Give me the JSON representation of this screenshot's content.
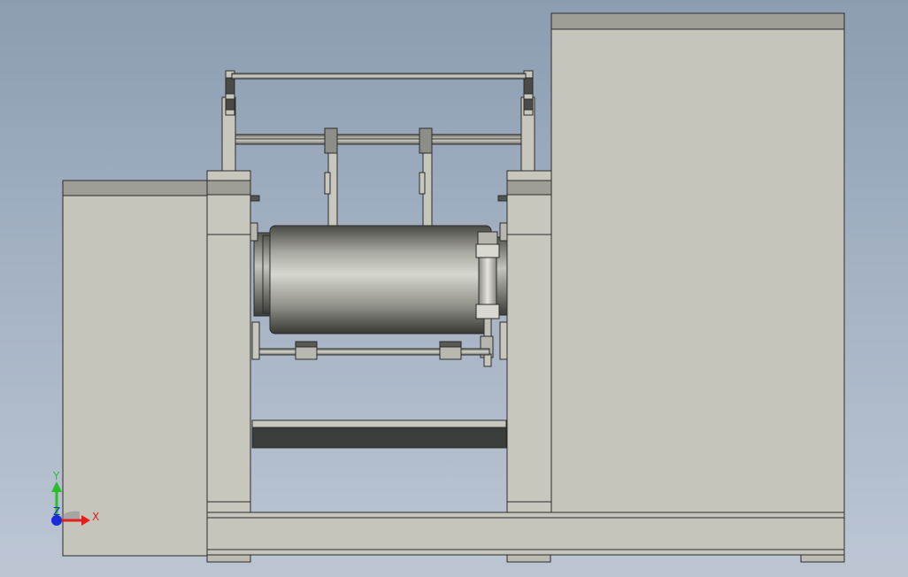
{
  "colors": {
    "background_top": "#8c9db1",
    "background_bottom": "#bcc6d3",
    "panel_face": "#c8c7bd",
    "panel_top": "#9e9e97",
    "edge": "#2b2b2b",
    "roller_mid": "#cfd0c8",
    "roller_dark": "#3e3e3a",
    "tray_dark": "#3b3d3b",
    "axis_x": "#e0201c",
    "axis_y": "#2bbd2b",
    "axis_z": "#1a2cd8"
  },
  "triad": {
    "x_label": "X",
    "y_label": "Y",
    "z_label": "Z"
  },
  "icons": {
    "triad": "coordinate-triad-icon"
  }
}
